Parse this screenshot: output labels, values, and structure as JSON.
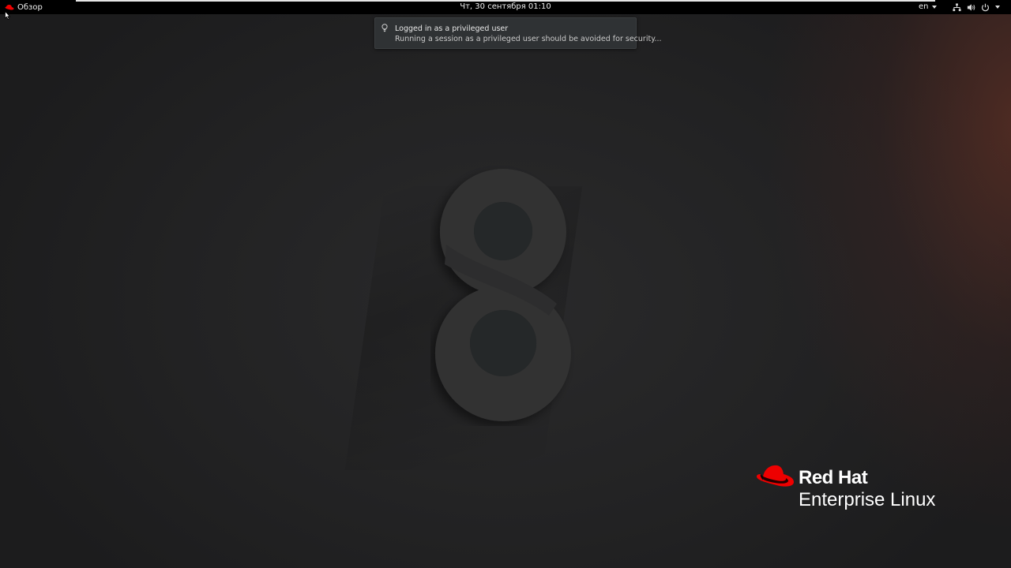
{
  "topbar": {
    "activities_label": "Обзор",
    "activities_icon": "redhat-icon",
    "clock": "Чт, 30 сентября  01:10",
    "language": "en",
    "tray_icons": [
      "network-icon",
      "volume-icon",
      "power-icon"
    ]
  },
  "notification": {
    "icon": "lightbulb-icon",
    "title": "Logged in as a privileged user",
    "body": "Running a session as a privileged user should be avoided for security..."
  },
  "branding": {
    "line1": "Red Hat",
    "line2": "Enterprise Linux",
    "hat_color": "#ee0000"
  },
  "wallpaper": {
    "accent_icon": "number-eight-icon"
  }
}
